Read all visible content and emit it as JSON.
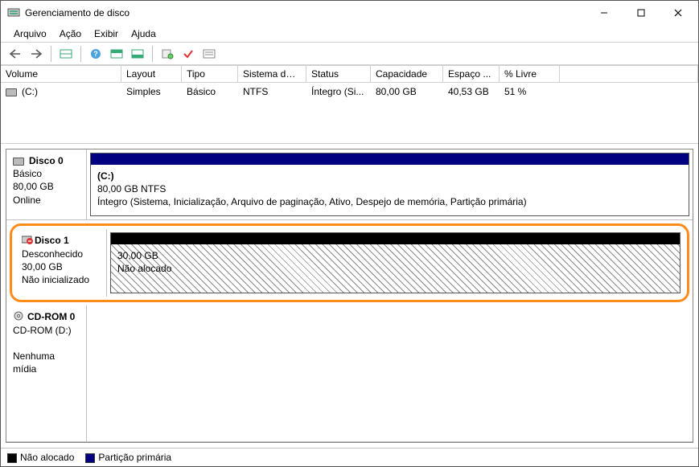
{
  "window": {
    "title": "Gerenciamento de disco"
  },
  "menu": {
    "items": [
      "Arquivo",
      "Ação",
      "Exibir",
      "Ajuda"
    ]
  },
  "grid": {
    "headers": [
      "Volume",
      "Layout",
      "Tipo",
      "Sistema de ...",
      "Status",
      "Capacidade",
      "Espaço ...",
      "% Livre"
    ],
    "row0": {
      "volume": "(C:)",
      "layout": "Simples",
      "tipo": "Básico",
      "fs": "NTFS",
      "status": "Íntegro (Si...",
      "cap": "80,00 GB",
      "free": "40,53 GB",
      "pct": "51 %"
    }
  },
  "disk0": {
    "name": "Disco 0",
    "type": "Básico",
    "size": "80,00 GB",
    "state": "Online",
    "part": {
      "label": "(C:)",
      "size_fs": "80,00 GB NTFS",
      "status": "Íntegro (Sistema, Inicialização, Arquivo de paginação, Ativo, Despejo de memória, Partição primária)"
    }
  },
  "disk1": {
    "name": "Disco 1",
    "type": "Desconhecido",
    "size": "30,00 GB",
    "state": "Não inicializado",
    "part": {
      "size": "30,00 GB",
      "status": "Não alocado"
    }
  },
  "cdrom": {
    "name": "CD-ROM 0",
    "type": "CD-ROM (D:)",
    "state": "Nenhuma mídia"
  },
  "legend": {
    "unalloc": "Não alocado",
    "primary": "Partição primária"
  }
}
